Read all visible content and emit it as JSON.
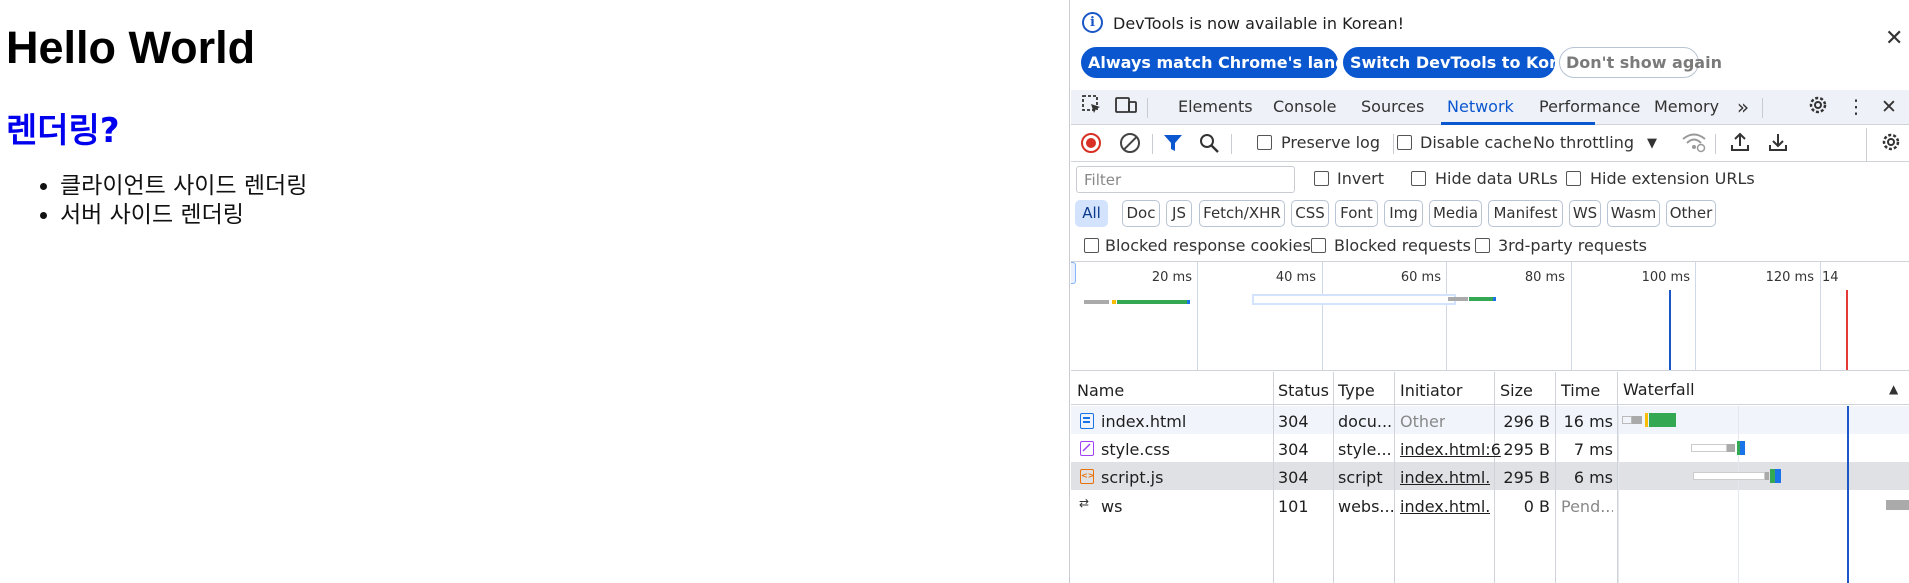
{
  "page": {
    "heading": "Hello World",
    "subheading": "렌더링?",
    "list_items": [
      "클라이언트 사이드 렌더링",
      "서버 사이드 렌더링"
    ]
  },
  "devtools": {
    "infobar": {
      "message": "DevTools is now available in Korean!",
      "btn_match": "Always match Chrome's language",
      "btn_switch": "Switch DevTools to Korean",
      "btn_dismiss": "Don't show again"
    },
    "tabs": [
      "Elements",
      "Console",
      "Sources",
      "Network",
      "Performance",
      "Memory"
    ],
    "active_tab": "Network",
    "toolbar": {
      "preserve_log": "Preserve log",
      "disable_cache": "Disable cache",
      "throttling": "No throttling"
    },
    "filter": {
      "placeholder": "Filter",
      "invert": "Invert",
      "hide_data_urls": "Hide data URLs",
      "hide_extension_urls": "Hide extension URLs",
      "types": [
        "All",
        "Doc",
        "JS",
        "Fetch/XHR",
        "CSS",
        "Font",
        "Img",
        "Media",
        "Manifest",
        "WS",
        "Wasm",
        "Other"
      ],
      "active_type": "All",
      "blocked_cookies": "Blocked response cookies",
      "blocked_requests": "Blocked requests",
      "third_party": "3rd-party requests"
    },
    "overview_ticks": [
      "20 ms",
      "40 ms",
      "60 ms",
      "80 ms",
      "100 ms",
      "120 ms",
      "14"
    ],
    "table": {
      "columns": [
        "Name",
        "Status",
        "Type",
        "Initiator",
        "Size",
        "Time",
        "Waterfall"
      ],
      "rows": [
        {
          "name": "index.html",
          "status": "304",
          "type": "docu...",
          "initiator": "Other",
          "size": "296 B",
          "time": "16 ms"
        },
        {
          "name": "style.css",
          "status": "304",
          "type": "style...",
          "initiator": "index.html:6",
          "size": "295 B",
          "time": "7 ms"
        },
        {
          "name": "script.js",
          "status": "304",
          "type": "script",
          "initiator": "index.html...",
          "size": "295 B",
          "time": "6 ms"
        },
        {
          "name": "ws",
          "status": "101",
          "type": "webs...",
          "initiator": "index.html...",
          "size": "0 B",
          "time": "Pend..."
        }
      ]
    },
    "colors": {
      "accent": "#0b57d0",
      "record": "#d93025",
      "waterfall_green": "#34a853",
      "waterfall_blue": "#1a73e8",
      "dom_content_loaded": "#1a56c8",
      "load_line": "#e53935"
    }
  }
}
